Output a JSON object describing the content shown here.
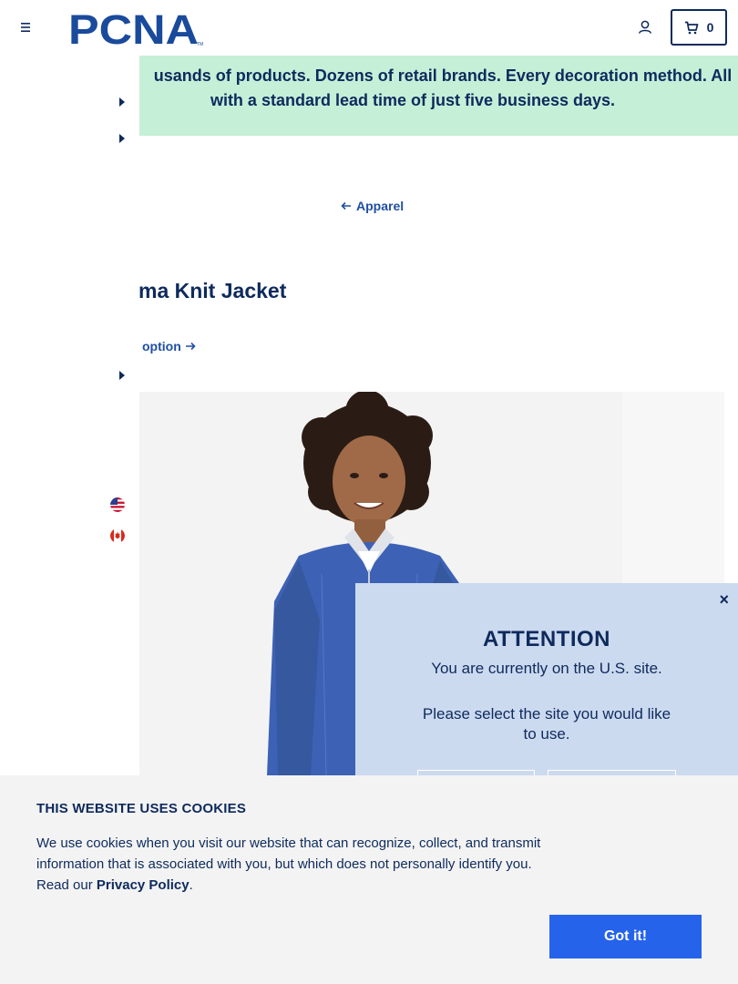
{
  "header": {
    "logo_text": "PCNA",
    "logo_tm": "TM",
    "cart_count": "0"
  },
  "banner": {
    "line1": "usands of products. Dozens of retail brands. Every decoration method. All",
    "line2": "with a standard lead time of just five business days."
  },
  "breadcrumb": {
    "back_label": "Apparel"
  },
  "product": {
    "title": "ma Knit Jacket",
    "option_link": "option"
  },
  "attention": {
    "close": "×",
    "title": "ATTENTION",
    "current_site": "You are currently on the U.S. site.",
    "prompt": "Please select the site you would like to use."
  },
  "cookie": {
    "title": "THIS WEBSITE USES COOKIES",
    "text": "We use cookies when you visit our website that can recognize, collect, and transmit information that is associated with you, but which does not personally identify you. Read our ",
    "policy_link": "Privacy Policy",
    "period": ".",
    "button": "Got it!"
  },
  "colors": {
    "navy": "#0e2a5c",
    "banner_green": "#c6efd8",
    "link_blue": "#1f4fa3",
    "modal_bg": "#ccdaf0",
    "cookie_bg": "#f3f3f3",
    "button_blue": "#2563eb",
    "jacket_blue": "#3d62b5"
  },
  "icons": {
    "menu": "hamburger-icon",
    "account": "user-icon",
    "cart": "cart-icon",
    "back": "arrow-left-icon",
    "forward": "arrow-right-icon",
    "caret": "caret-right-icon",
    "flags": [
      "us-flag-icon",
      "canada-flag-icon"
    ]
  }
}
